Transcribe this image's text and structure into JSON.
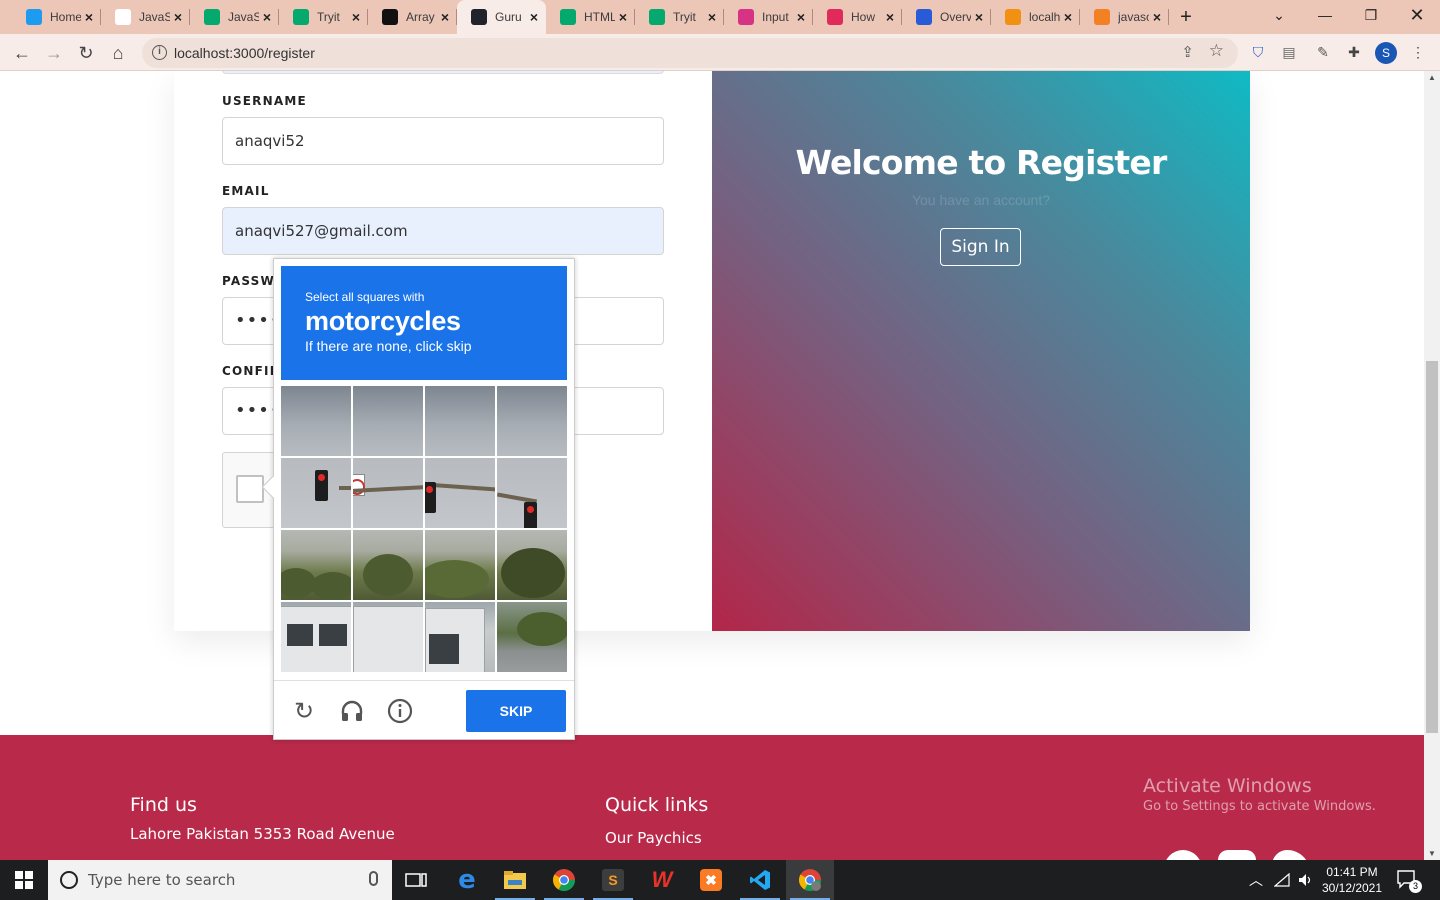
{
  "browser": {
    "tabs": [
      {
        "title": "Home",
        "icon": "twitter-icon",
        "color": "#1d9bf0"
      },
      {
        "title": "JavaScript",
        "icon": "w3schools-icon",
        "color": "#ffffff"
      },
      {
        "title": "JavaScript",
        "icon": "w3schools-w-icon",
        "color": "#04aa6d"
      },
      {
        "title": "Tryit",
        "icon": "w3schools-w-icon",
        "color": "#04aa6d"
      },
      {
        "title": "Array",
        "icon": "codepen-icon",
        "color": "#111111"
      },
      {
        "title": "Guru",
        "icon": "react-icon",
        "color": "#20232a"
      },
      {
        "title": "HTML",
        "icon": "w3schools-w-icon",
        "color": "#04aa6d"
      },
      {
        "title": "Tryit",
        "icon": "w3schools-w-icon",
        "color": "#04aa6d"
      },
      {
        "title": "Input",
        "icon": "hashnode-icon",
        "color": "#d63384"
      },
      {
        "title": "How",
        "icon": "youtube-icon",
        "color": "#e02a5a"
      },
      {
        "title": "Overview",
        "icon": "hex-icon",
        "color": "#2a5bd7"
      },
      {
        "title": "localhost",
        "icon": "phpmyadmin-icon",
        "color": "#f29111"
      },
      {
        "title": "javascript",
        "icon": "stackoverflow-icon",
        "color": "#f48024"
      }
    ],
    "new_tab_label": "+",
    "url": "localhost:3000/register"
  },
  "form": {
    "username_label": "USERNAME",
    "username_value": "anaqvi52",
    "email_label": "EMAIL",
    "email_value": "anaqvi527@gmail.com",
    "password_label": "PASSWORD",
    "password_value": "••••••••",
    "confirm_label": "CONFIRM PASSWORD",
    "confirm_value": "••••••••"
  },
  "welcome": {
    "title": "Welcome to Register",
    "subtitle": "You have an account?",
    "signin_label": "Sign In",
    "gradient_start": "#b32649",
    "gradient_end": "#0fbac4"
  },
  "captcha": {
    "instruction_line1": "Select all squares with",
    "target": "motorcycles",
    "instruction_line3": "If there are none, click skip",
    "skip_label": "SKIP",
    "header_color": "#1a73e8"
  },
  "footer": {
    "find_us_title": "Find us",
    "address": "Lahore Pakistan 5353 Road Avenue",
    "quick_links_title": "Quick links",
    "link1": "Our Paychics",
    "background": "#b9294a"
  },
  "watermark": {
    "line1": "Activate Windows",
    "line2": "Go to Settings to activate Windows."
  },
  "taskbar": {
    "search_placeholder": "Type here to search",
    "time": "01:41 PM",
    "date": "30/12/2021",
    "notification_count": "3"
  }
}
